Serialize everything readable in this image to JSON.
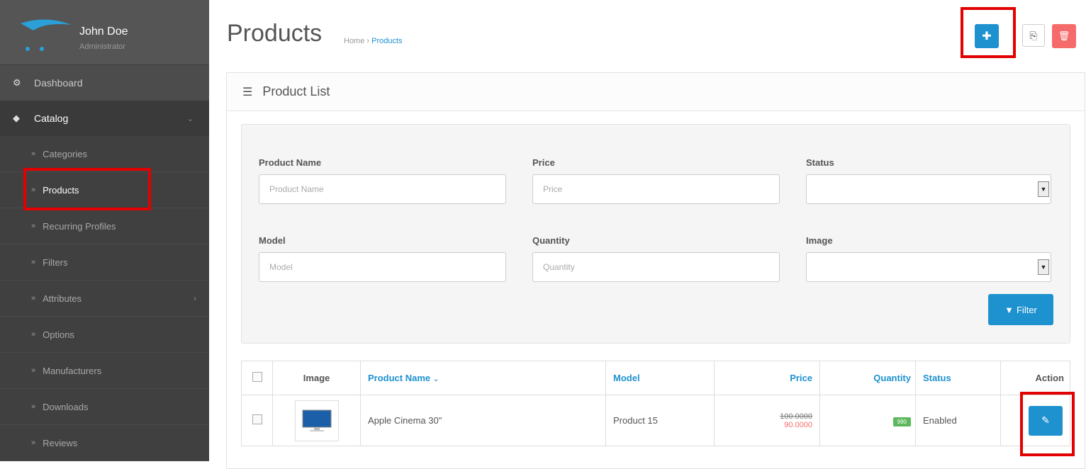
{
  "user": {
    "name": "John Doe",
    "role": "Administrator"
  },
  "nav": {
    "dashboard": "Dashboard",
    "catalog": "Catalog",
    "submenu": [
      "Categories",
      "Products",
      "Recurring Profiles",
      "Filters",
      "Attributes",
      "Options",
      "Manufacturers",
      "Downloads",
      "Reviews"
    ]
  },
  "page": {
    "title": "Products",
    "breadcrumb_home": "Home",
    "breadcrumb_sep": "›",
    "breadcrumb_current": "Products"
  },
  "toolbar": {
    "add_icon": "plus-icon",
    "copy_icon": "copy-icon",
    "delete_icon": "trash-icon"
  },
  "panel": {
    "title": "Product List"
  },
  "filters": {
    "product_name_label": "Product Name",
    "product_name_placeholder": "Product Name",
    "price_label": "Price",
    "price_placeholder": "Price",
    "status_label": "Status",
    "model_label": "Model",
    "model_placeholder": "Model",
    "quantity_label": "Quantity",
    "quantity_placeholder": "Quantity",
    "image_label": "Image",
    "filter_button": "Filter"
  },
  "table": {
    "headers": {
      "image": "Image",
      "name": "Product Name",
      "model": "Model",
      "price": "Price",
      "quantity": "Quantity",
      "status": "Status",
      "action": "Action"
    },
    "rows": [
      {
        "name": "Apple Cinema 30\"",
        "model": "Product 15",
        "price_old": "100.0000",
        "price_special": "90.0000",
        "quantity": "990",
        "status": "Enabled"
      }
    ]
  },
  "colors": {
    "primary": "#1e91cf",
    "danger": "#f56b6b",
    "highlight": "#e20000",
    "sidebar": "#4c4c4c"
  }
}
